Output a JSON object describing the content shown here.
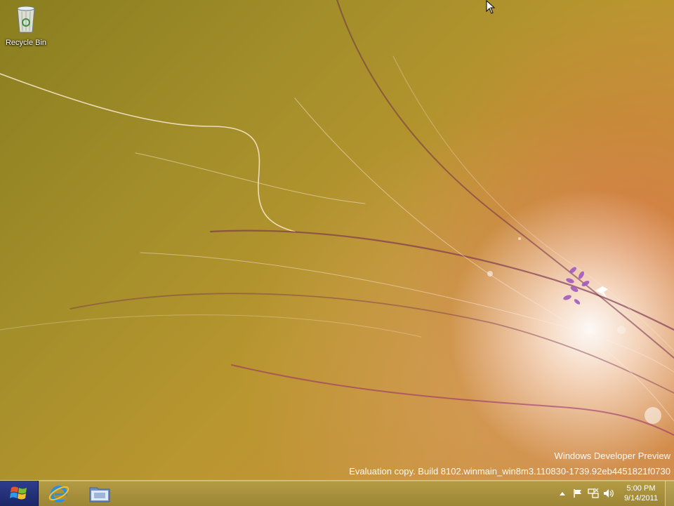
{
  "desktop": {
    "icons": [
      {
        "label": "Recycle Bin",
        "icon": "recycle-bin-icon"
      }
    ],
    "watermark": {
      "line1": "Windows Developer Preview",
      "line2": "Evaluation copy. Build 8102.winmain_win8m3.110830-1739.92eb4451821f0730"
    }
  },
  "taskbar": {
    "start_icon": "windows-logo-icon",
    "pinned": [
      {
        "name": "Internet Explorer",
        "icon": "internet-explorer-icon"
      },
      {
        "name": "Windows Explorer",
        "icon": "folder-icon"
      }
    ],
    "tray": {
      "icons": [
        "show-hidden-icons-arrow",
        "action-center-flag-icon",
        "network-icon",
        "volume-icon"
      ],
      "time": "5:00 PM",
      "date": "9/14/2011"
    }
  },
  "colors": {
    "taskbar": "#a8913c",
    "start_button": "#24307a",
    "desktop_base": "#a38e2a",
    "glow": "#ffffff"
  }
}
